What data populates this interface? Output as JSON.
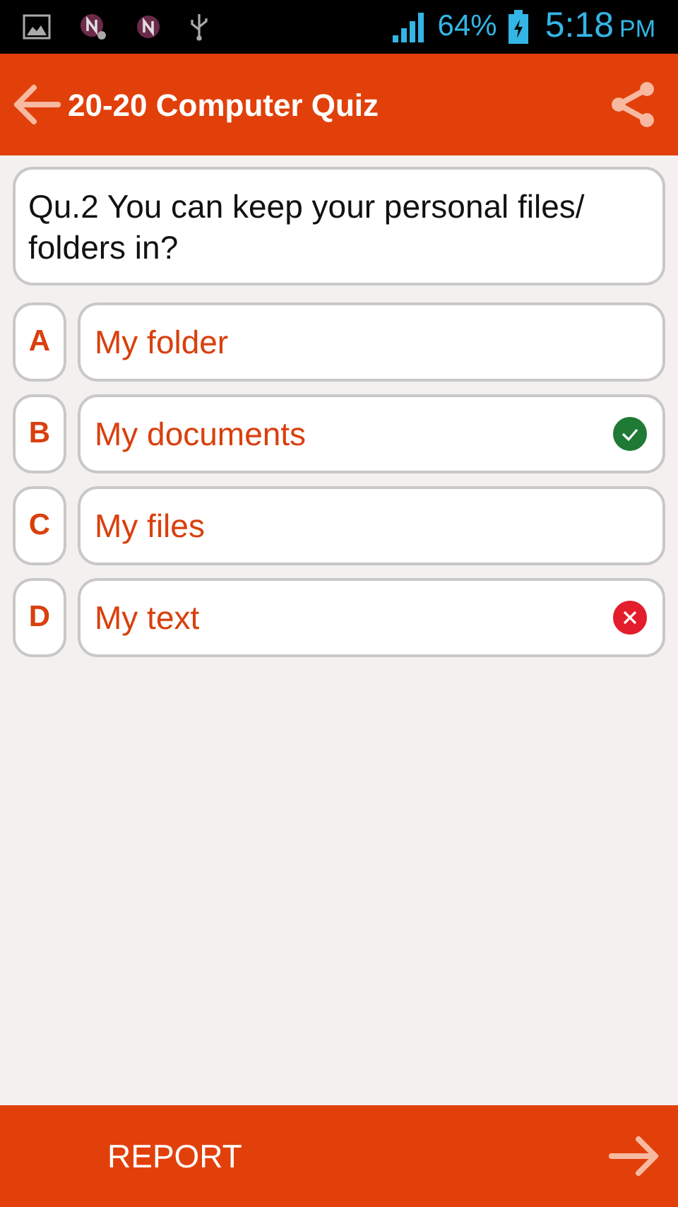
{
  "status_bar": {
    "battery": "64%",
    "time": "5:18",
    "period": "PM"
  },
  "toolbar": {
    "title": "20-20 Computer Quiz"
  },
  "question": "Qu.2 You can keep your personal files/ folders in?",
  "options": [
    {
      "letter": "A",
      "text": "My folder",
      "correct": false,
      "wrong": false
    },
    {
      "letter": "B",
      "text": "My documents",
      "correct": true,
      "wrong": false
    },
    {
      "letter": "C",
      "text": "My files",
      "correct": false,
      "wrong": false
    },
    {
      "letter": "D",
      "text": "My text",
      "correct": false,
      "wrong": true
    }
  ],
  "bottom_bar": {
    "report": "REPORT"
  }
}
